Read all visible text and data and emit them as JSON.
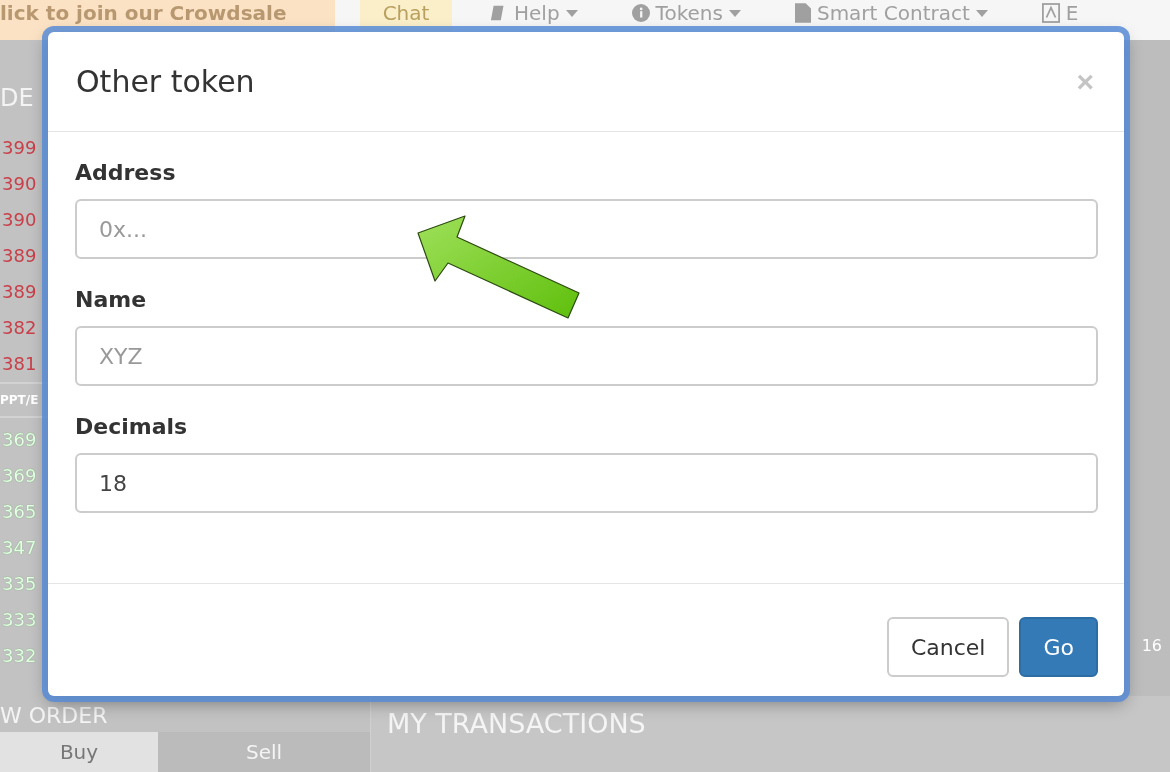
{
  "nav": {
    "banner": "lick to join our Crowdsale",
    "chat": "Chat",
    "menus": [
      {
        "label": "Help",
        "kind": "book",
        "caret": true
      },
      {
        "label": "Tokens",
        "kind": "info",
        "caret": true
      },
      {
        "label": "Smart Contract",
        "kind": "file",
        "caret": true
      },
      {
        "label": "E",
        "kind": "language",
        "caret": false
      }
    ]
  },
  "order_book": {
    "title": "DE",
    "sells": [
      "399",
      "390",
      "390",
      "389",
      "389",
      "382",
      "381"
    ],
    "pair": "PPT/E",
    "buys": [
      "369",
      "369",
      "365",
      "347",
      "335",
      "333",
      "332"
    ]
  },
  "new_order": {
    "title": "W ORDER",
    "tabs": [
      {
        "label": "Buy",
        "selected": true
      },
      {
        "label": "Sell",
        "selected": false
      }
    ]
  },
  "chart": {
    "axis_label": "16"
  },
  "transactions": {
    "title": "MY TRANSACTIONS"
  },
  "modal": {
    "title": "Other token",
    "close": "×",
    "fields": [
      {
        "label": "Address",
        "placeholder": "0x..."
      },
      {
        "label": "Name",
        "placeholder": "XYZ"
      },
      {
        "label": "Decimals",
        "value": "18"
      }
    ],
    "buttons": [
      {
        "label": "Cancel",
        "kind": "default"
      },
      {
        "label": "Go",
        "kind": "primary"
      }
    ]
  }
}
